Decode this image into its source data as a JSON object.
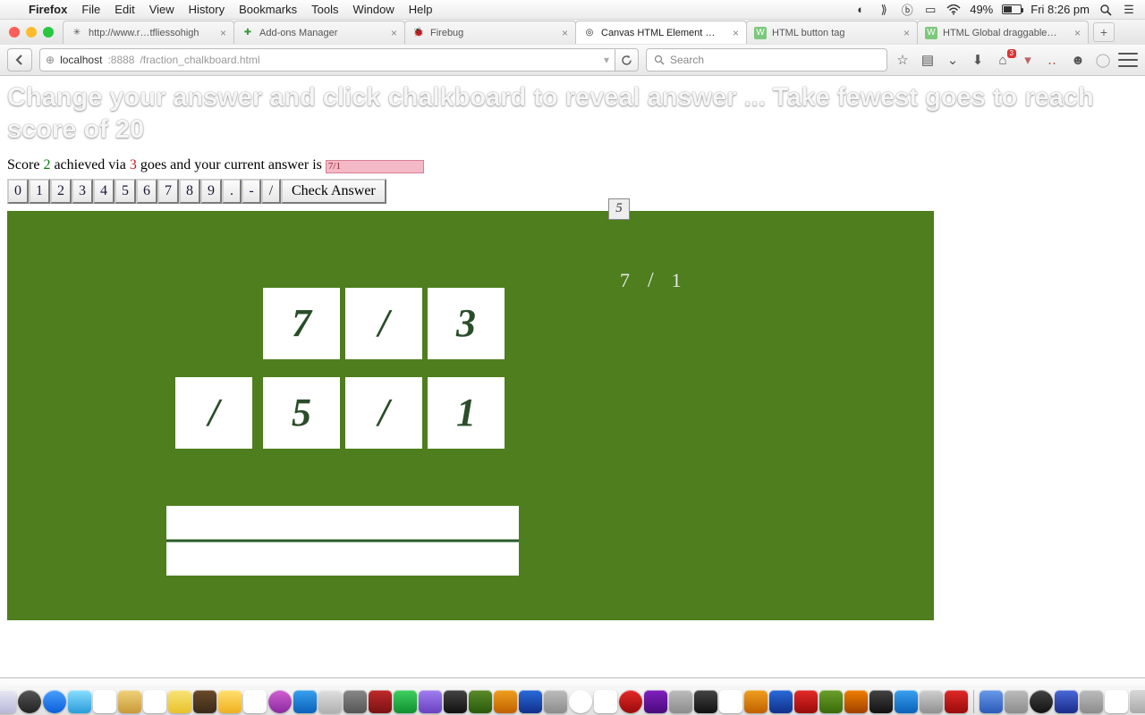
{
  "menubar": {
    "app": "Firefox",
    "items": [
      "File",
      "Edit",
      "View",
      "History",
      "Bookmarks",
      "Tools",
      "Window",
      "Help"
    ],
    "battery_pct": "49%",
    "clock": "Fri 8:26 pm"
  },
  "tabs": [
    {
      "title": "http://www.r…tfliessohigh",
      "active": false
    },
    {
      "title": "Add-ons Manager",
      "active": false
    },
    {
      "title": "Firebug",
      "active": false
    },
    {
      "title": "Canvas HTML Element …",
      "active": true
    },
    {
      "title": "HTML button tag",
      "active": false
    },
    {
      "title": "HTML Global draggable…",
      "active": false
    }
  ],
  "url": {
    "host": "localhost",
    "port": ":8888",
    "path": "/fraction_chalkboard.html"
  },
  "search_placeholder": "Search",
  "home_badge": "3",
  "page": {
    "heading": "Change your answer and click chalkboard to reveal answer ... Take fewest goes to reach score of 20",
    "score_prefix": "Score ",
    "score": "2",
    "via": " achieved via ",
    "goes": "3",
    "after": " goes and your current answer is ",
    "answer": "7/1",
    "digits": [
      "0",
      "1",
      "2",
      "3",
      "4",
      "5",
      "6",
      "7",
      "8",
      "9",
      ".",
      "-",
      "/"
    ],
    "check": "Check Answer"
  },
  "chalk": {
    "drag_tile": "5",
    "echo_n": "7",
    "echo_s": "/",
    "echo_d": "1",
    "top": {
      "a": "7",
      "op": "/",
      "b": "3"
    },
    "op": "/",
    "bot": {
      "a": "5",
      "op": "/",
      "b": "1"
    }
  },
  "colors": {
    "board": "#4e7e1e",
    "ink": "#2a4d2a"
  }
}
